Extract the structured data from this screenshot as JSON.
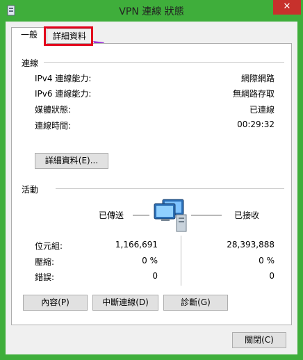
{
  "window": {
    "title": "VPN 連線 狀態",
    "close_glyph": "✕"
  },
  "tabs": [
    {
      "label": "一般"
    },
    {
      "label": "詳細資料"
    }
  ],
  "connection": {
    "heading": "連線",
    "rows": [
      {
        "label": "IPv4 連線能力:",
        "value": "網際網路"
      },
      {
        "label": "IPv6 連線能力:",
        "value": "無網路存取"
      },
      {
        "label": "媒體狀態:",
        "value": "已連線"
      },
      {
        "label": "連線時間:",
        "value": "00:29:32"
      }
    ],
    "details_button": "詳細資料(E)..."
  },
  "activity": {
    "heading": "活動",
    "sent_label": "已傳送",
    "received_label": "已接收",
    "rows": [
      {
        "label": "位元組:",
        "sent": "1,166,691",
        "received": "28,393,888"
      },
      {
        "label": "壓縮:",
        "sent": "0 %",
        "received": "0 %"
      },
      {
        "label": "錯誤:",
        "sent": "0",
        "received": "0"
      }
    ]
  },
  "buttons": {
    "properties": "內容(P)",
    "disconnect": "中斷連線(D)",
    "diagnose": "診斷(G)",
    "close": "關閉(C)"
  },
  "colors": {
    "accent": "#3fae3b",
    "highlight": "#e3001b",
    "arrow": "#9b30d9"
  }
}
